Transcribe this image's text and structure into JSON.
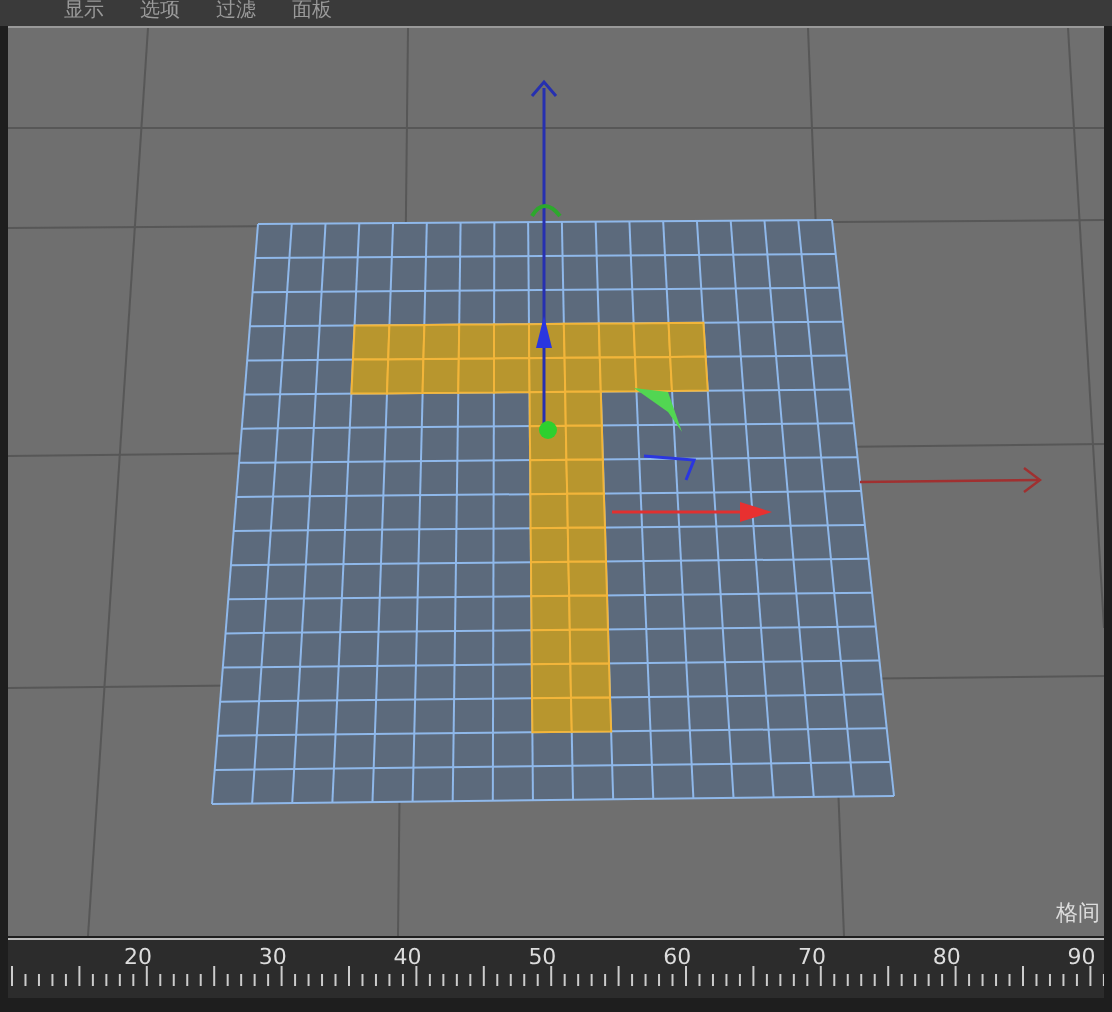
{
  "menu": [
    "显示",
    "选项",
    "过滤",
    "面板"
  ],
  "viewport": {
    "status_text": "格间"
  },
  "timeline": {
    "labels": [
      "20",
      "30",
      "40",
      "50",
      "60",
      "70",
      "80",
      "90"
    ]
  }
}
